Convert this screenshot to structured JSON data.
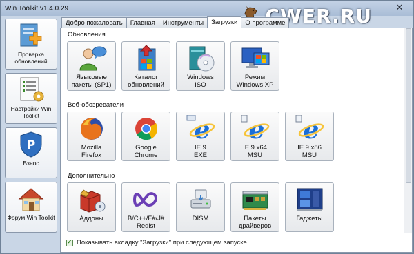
{
  "window": {
    "title": "Win Toolkit v1.4.0.29",
    "brand": "CWER.RU",
    "close_glyph": "✕"
  },
  "sidebar": {
    "items": [
      {
        "label": "Проверка обновлений",
        "icon": "update-check-icon"
      },
      {
        "label": "Настройки Win Toolkit",
        "icon": "settings-icon"
      },
      {
        "label": "Взнос",
        "icon": "paypal-icon"
      },
      {
        "label": "Форум Win Toolkit",
        "icon": "forum-home-icon"
      }
    ]
  },
  "tabs": [
    "Добро пожаловать",
    "Главная",
    "Инструменты",
    "Загрузки",
    "О программе"
  ],
  "active_tab": "Загрузки",
  "sections": {
    "updates": {
      "title": "Обновления",
      "items": [
        "Языковые\nпакеты (SP1)",
        "Каталог\nобновлений",
        "Windows\nISO",
        "Режим\nWindows XP"
      ]
    },
    "browsers": {
      "title": "Веб-обозреватели",
      "items": [
        "Mozilla\nFirefox",
        "Google\nChrome",
        "IE 9\nEXE",
        "IE 9 x64\nMSU",
        "IE 9 x86\nMSU"
      ]
    },
    "extra": {
      "title": "Дополнительно",
      "items": [
        "Аддоны",
        "B/C++/F#/J#\nRedist",
        "DISM",
        "Пакеты\nдрайверов",
        "Гаджеты"
      ]
    }
  },
  "footer": {
    "checkbox_label": "Показывать вкладку \"Загрузки\" при следующем запуске",
    "checked": true
  },
  "colors": {
    "window_bg": "#c9d6e6",
    "ie_blue": "#1a6fd8",
    "firefox_orange": "#e8731c"
  }
}
